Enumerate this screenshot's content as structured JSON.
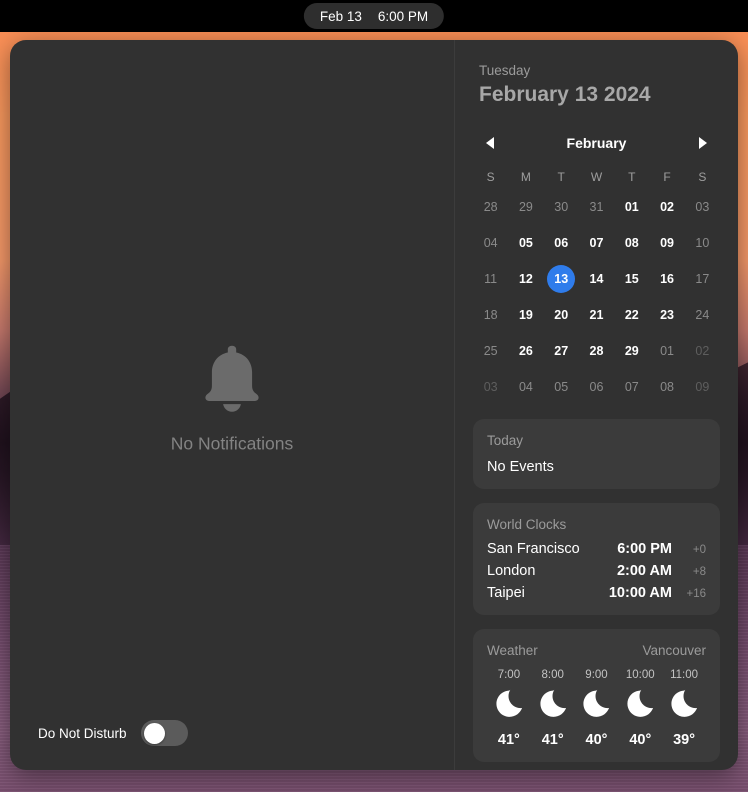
{
  "menubar": {
    "date": "Feb 13",
    "time": "6:00 PM"
  },
  "notifications": {
    "empty_label": "No Notifications",
    "bell_icon": "bell-icon",
    "do_not_disturb": {
      "label": "Do Not Disturb",
      "state": "off"
    }
  },
  "date_header": {
    "weekday": "Tuesday",
    "full_date": "February 13 2024"
  },
  "calendar": {
    "prev_icon": "chevron-left-icon",
    "next_icon": "chevron-right-icon",
    "month": "February",
    "weekday_labels": [
      "S",
      "M",
      "T",
      "W",
      "T",
      "F",
      "S"
    ],
    "selected_day": "13",
    "accent_color": "#2f7ceb",
    "weeks": [
      [
        {
          "label": "28",
          "style": "dim"
        },
        {
          "label": "29",
          "style": "dim"
        },
        {
          "label": "30",
          "style": "dim"
        },
        {
          "label": "31",
          "style": "dim"
        },
        {
          "label": "01",
          "style": "normal"
        },
        {
          "label": "02",
          "style": "normal"
        },
        {
          "label": "03",
          "style": "dim"
        }
      ],
      [
        {
          "label": "04",
          "style": "dim"
        },
        {
          "label": "05",
          "style": "normal"
        },
        {
          "label": "06",
          "style": "normal"
        },
        {
          "label": "07",
          "style": "normal"
        },
        {
          "label": "08",
          "style": "normal"
        },
        {
          "label": "09",
          "style": "normal"
        },
        {
          "label": "10",
          "style": "dim"
        }
      ],
      [
        {
          "label": "11",
          "style": "dim"
        },
        {
          "label": "12",
          "style": "normal"
        },
        {
          "label": "13",
          "style": "today"
        },
        {
          "label": "14",
          "style": "normal"
        },
        {
          "label": "15",
          "style": "normal"
        },
        {
          "label": "16",
          "style": "normal"
        },
        {
          "label": "17",
          "style": "dim"
        }
      ],
      [
        {
          "label": "18",
          "style": "dim"
        },
        {
          "label": "19",
          "style": "normal"
        },
        {
          "label": "20",
          "style": "normal"
        },
        {
          "label": "21",
          "style": "normal"
        },
        {
          "label": "22",
          "style": "normal"
        },
        {
          "label": "23",
          "style": "normal"
        },
        {
          "label": "24",
          "style": "dim"
        }
      ],
      [
        {
          "label": "25",
          "style": "dim"
        },
        {
          "label": "26",
          "style": "normal"
        },
        {
          "label": "27",
          "style": "normal"
        },
        {
          "label": "28",
          "style": "normal"
        },
        {
          "label": "29",
          "style": "normal"
        },
        {
          "label": "01",
          "style": "dim"
        },
        {
          "label": "02",
          "style": "dimmer"
        }
      ],
      [
        {
          "label": "03",
          "style": "dimmer"
        },
        {
          "label": "04",
          "style": "dim"
        },
        {
          "label": "05",
          "style": "dim"
        },
        {
          "label": "06",
          "style": "dim"
        },
        {
          "label": "07",
          "style": "dim"
        },
        {
          "label": "08",
          "style": "dim"
        },
        {
          "label": "09",
          "style": "dimmer"
        }
      ]
    ]
  },
  "today_card": {
    "title": "Today",
    "events_text": "No Events"
  },
  "world_clocks": {
    "title": "World Clocks",
    "rows": [
      {
        "city": "San Francisco",
        "time": "6:00 PM",
        "offset": "+0"
      },
      {
        "city": "London",
        "time": "2:00 AM",
        "offset": "+8"
      },
      {
        "city": "Taipei",
        "time": "10:00 AM",
        "offset": "+16"
      }
    ]
  },
  "weather": {
    "title": "Weather",
    "location": "Vancouver",
    "hours": [
      {
        "time": "7:00",
        "icon": "moon-icon",
        "temp": "41°"
      },
      {
        "time": "8:00",
        "icon": "moon-icon",
        "temp": "41°"
      },
      {
        "time": "9:00",
        "icon": "moon-icon",
        "temp": "40°"
      },
      {
        "time": "10:00",
        "icon": "moon-icon",
        "temp": "40°"
      },
      {
        "time": "11:00",
        "icon": "moon-icon",
        "temp": "39°"
      }
    ]
  }
}
